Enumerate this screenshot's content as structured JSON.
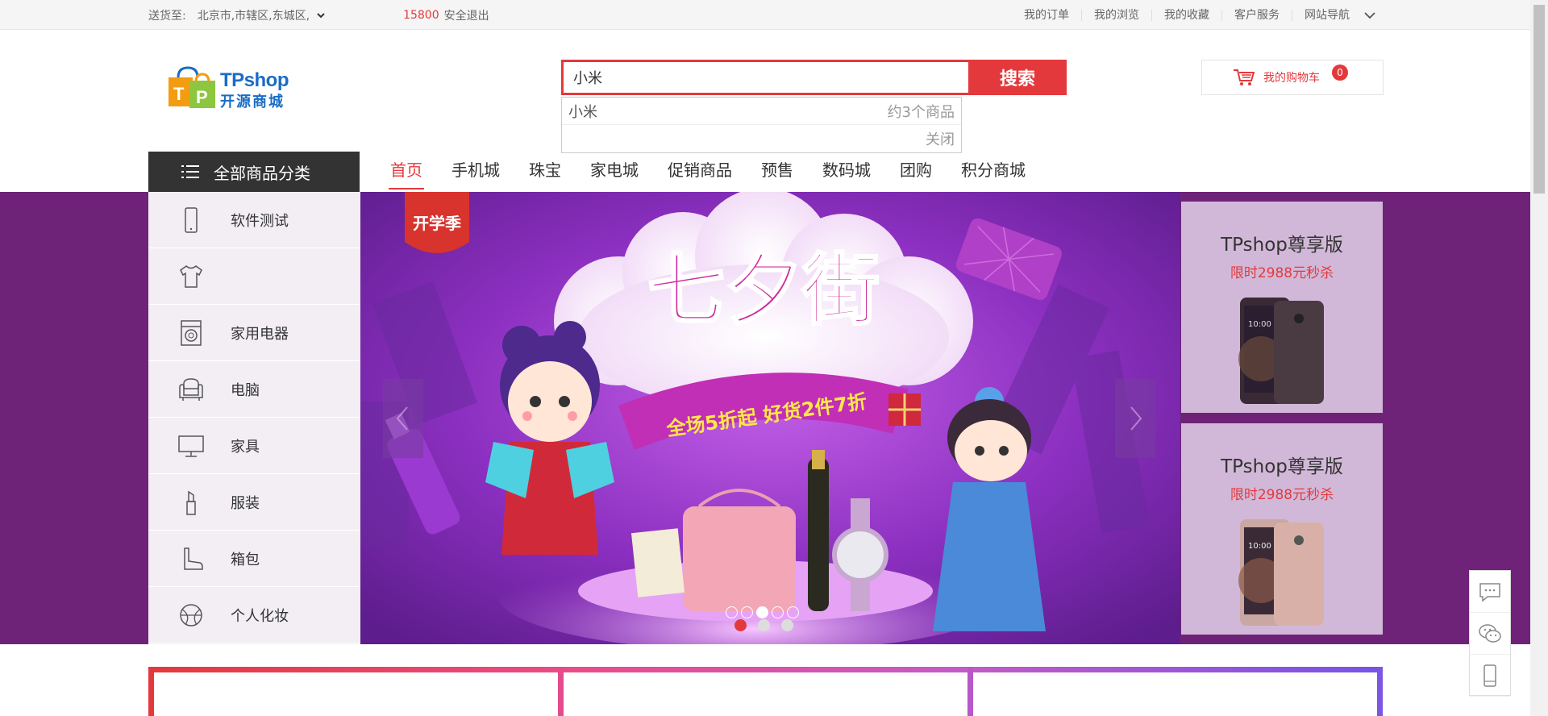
{
  "topbar": {
    "deliver_label": "送货至:",
    "address": "北京市,市辖区,东城区,",
    "user": "15800",
    "logout": "安全退出",
    "links": [
      "我的订单",
      "我的浏览",
      "我的收藏",
      "客户服务",
      "网站导航"
    ]
  },
  "logo": {
    "line1": "TPshop",
    "line2": "开源商城"
  },
  "search": {
    "value": "小米",
    "button": "搜索"
  },
  "suggest": {
    "keyword": "小米",
    "count": "约3个商品",
    "close": "关闭"
  },
  "cart": {
    "label": "我的购物车",
    "count": "0"
  },
  "nav": {
    "all_categories": "全部商品分类",
    "items": [
      "首页",
      "手机城",
      "珠宝",
      "家电城",
      "促销商品",
      "预售",
      "数码城",
      "团购",
      "积分商城"
    ]
  },
  "sidebar": {
    "items": [
      {
        "label": "软件测试",
        "icon": "phone-icon"
      },
      {
        "label": "",
        "icon": "tshirt-icon"
      },
      {
        "label": "家用电器",
        "icon": "washer-icon"
      },
      {
        "label": "电脑",
        "icon": "sofa-icon"
      },
      {
        "label": "家具",
        "icon": "monitor-icon"
      },
      {
        "label": "服装",
        "icon": "lipstick-icon"
      },
      {
        "label": "箱包",
        "icon": "boot-icon"
      },
      {
        "label": "个人化妆",
        "icon": "ball-icon"
      }
    ]
  },
  "banner": {
    "slide_count": 5,
    "active_slide": 3,
    "bottom_dots": 3,
    "active_bottom_dot": 1
  },
  "promos": [
    {
      "title": "TPshop尊享版",
      "subtitle": "限时2988元秒杀"
    },
    {
      "title": "TPshop尊享版",
      "subtitle": "限时2988元秒杀"
    }
  ],
  "colors": {
    "accent": "#e4393c",
    "banner_bg": "#6e2378",
    "nav_dark": "#333333"
  }
}
